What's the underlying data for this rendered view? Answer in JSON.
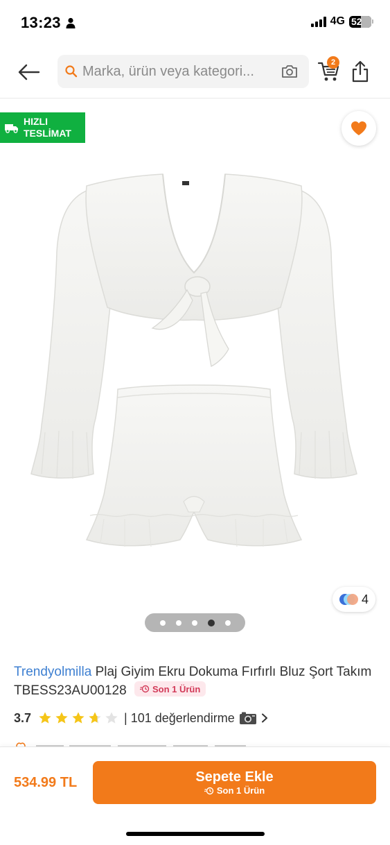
{
  "status_bar": {
    "time": "13:23",
    "network": "4G",
    "battery": "52",
    "battery_level": 0.52
  },
  "header": {
    "search_placeholder": "Marka, ürün veya kategori...",
    "cart_count": "2"
  },
  "product": {
    "fast_delivery_line1": "HIZLI",
    "fast_delivery_line2": "TESLİMAT",
    "color_count": "4",
    "gallery_total": 5,
    "gallery_active_index": 3,
    "brand": "Trendyolmilla",
    "name": "Plaj Giyim Ekru Dokuma Fırfırlı Bluz Şort Takım TBESS23AU00128",
    "stock_tag": "Son 1 Ürün",
    "rating": "3.7",
    "rating_value": 3.7,
    "review_text": "| 101 değerlendirme"
  },
  "bottom_bar": {
    "price": "534.99 TL",
    "add_to_cart_label": "Sepete Ekle",
    "add_to_cart_sub": "Son 1 Ürün"
  },
  "colors": {
    "accent": "#f27a1a",
    "fast_badge": "#10b040",
    "brand_link": "#3d7fd1",
    "stock_tag_bg": "#fde8ec",
    "stock_tag_text": "#d23a58",
    "star": "#f5c518"
  }
}
